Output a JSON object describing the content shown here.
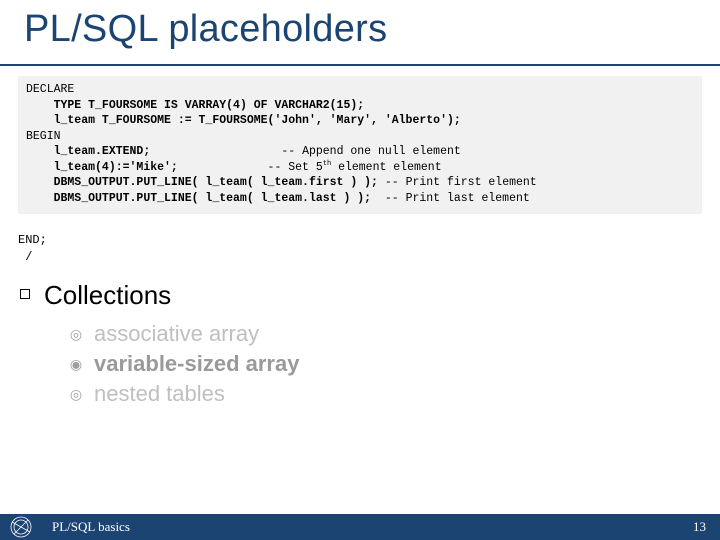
{
  "title": "PL/SQL placeholders",
  "code": {
    "l1": "DECLARE",
    "l2a": "    TYPE T_FOURSOME IS ",
    "l2b": "VARRAY(4) OF VARCHAR2(15);",
    "l3": "    l_team T_FOURSOME := T_FOURSOME('John', 'Mary', 'Alberto');",
    "l4": "BEGIN",
    "l5a": "    l_team.EXTEND;",
    "l5b": "-- Append one null element",
    "l6a": "    l_team(4):='Mike';",
    "l6b": "-- Set 5",
    "l6c": " element element",
    "l7a": "    DBMS_OUTPUT.PUT_LINE( l_team( l_team.first ) );",
    "l7b": " -- Print first element",
    "l8a": "    DBMS_OUTPUT.PUT_LINE( l_team( l_team.last ) );",
    "l8b": "  -- Print last element",
    "sup": "th"
  },
  "trailer": {
    "l1": "END;",
    "l2": " /"
  },
  "collections": {
    "heading": "Collections",
    "items": [
      {
        "label": "associative array",
        "highlight": false
      },
      {
        "label": "variable-sized array",
        "highlight": true
      },
      {
        "label": "nested tables",
        "highlight": false
      }
    ]
  },
  "footer": {
    "text": "PL/SQL basics",
    "page": "13"
  }
}
